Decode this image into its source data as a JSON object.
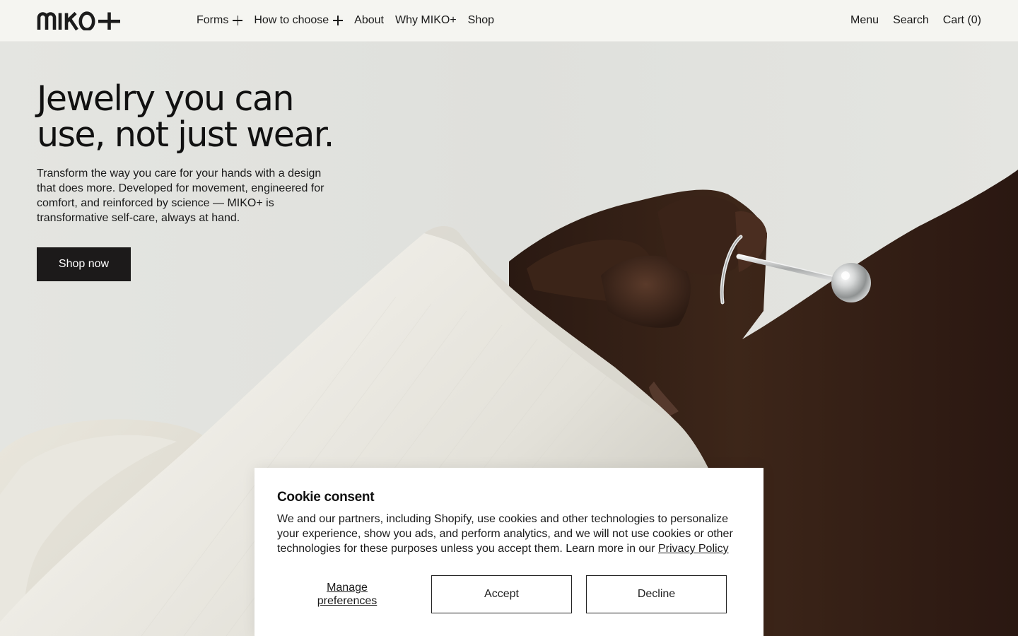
{
  "brand": {
    "logo_text": "MIKO+"
  },
  "nav": {
    "items": [
      {
        "label": "Forms",
        "has_plus": true
      },
      {
        "label": "How to choose",
        "has_plus": true
      },
      {
        "label": "About",
        "has_plus": false
      },
      {
        "label": "Why MIKO+",
        "has_plus": false
      },
      {
        "label": "Shop",
        "has_plus": false
      }
    ],
    "utility": {
      "menu": "Menu",
      "search": "Search",
      "cart": "Cart (0)"
    }
  },
  "hero": {
    "title_lines": [
      "Jewelry you can",
      "use, not just wear."
    ],
    "text_lines": [
      "Transform the way you care for your hands with a design",
      "that does more. Developed for movement, engineered for",
      "comfort, and reinforced by science — MIKO+ is",
      "transformative self-care, always at hand."
    ],
    "cta": "Shop now",
    "image_description_icon": "hand-with-ring-photo"
  },
  "cookie": {
    "title": "Cookie consent",
    "text_lines": [
      "We and our partners, including Shopify, use cookies and other technologies to personalize",
      "your experience, show you ads, and perform analytics, and we will not use cookies or other",
      "technologies for these purposes unless you accept them. Learn more in our"
    ],
    "link": "Privacy Policy",
    "manage_lines": [
      "Manage",
      "preferences"
    ],
    "accept": "Accept",
    "decline": "Decline"
  },
  "colors": {
    "header_bg": "#f5f5f1",
    "hero_bg": "#e4e5e1",
    "cta_bg": "#1c1a1a",
    "fabric": "#ebe8df",
    "skin": "#3a2419"
  }
}
